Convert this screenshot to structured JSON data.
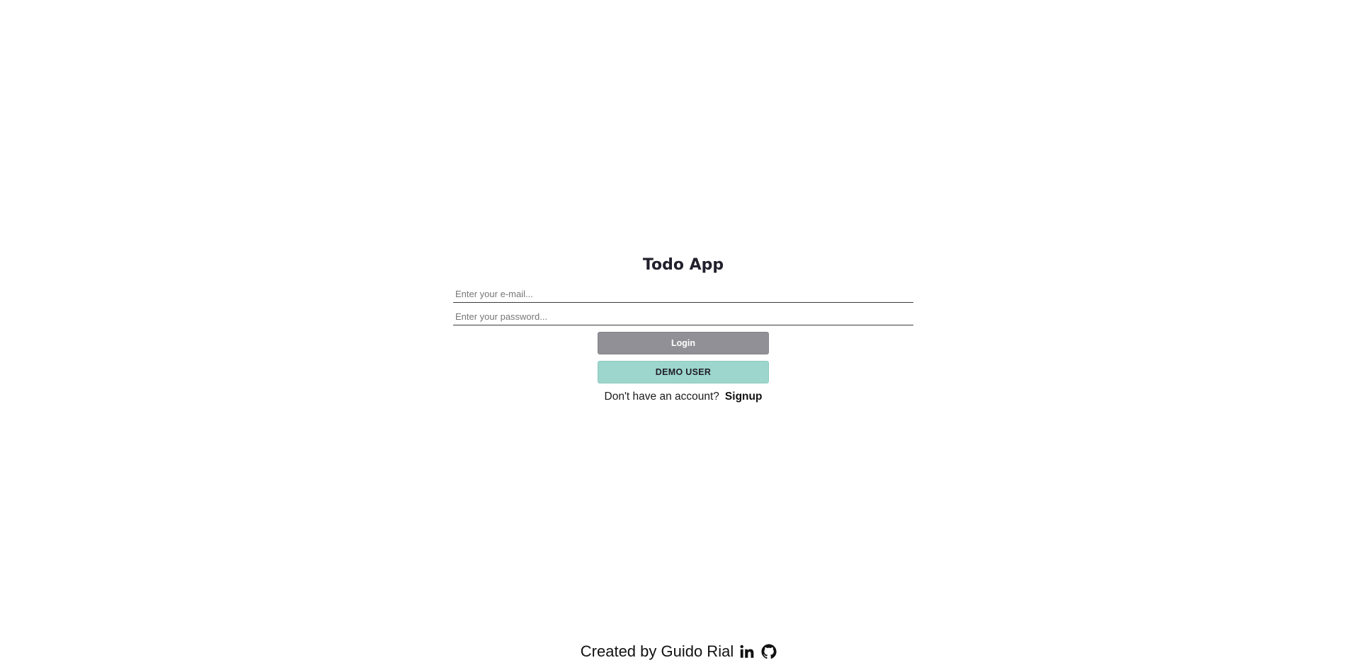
{
  "app": {
    "title": "Todo App"
  },
  "form": {
    "email_placeholder": "Enter your e-mail...",
    "email_value": "",
    "password_placeholder": "Enter your password...",
    "password_value": "",
    "login_label": "Login",
    "demo_label": "DEMO USER",
    "signup_prompt": "Don't have an account?",
    "signup_label": "Signup"
  },
  "footer": {
    "credit": "Created by Guido Rial",
    "icons": [
      "linkedin-icon",
      "github-icon"
    ]
  },
  "colors": {
    "login_button": "#919096",
    "demo_button": "#9dd6cc",
    "text": "#1f1d2b"
  }
}
